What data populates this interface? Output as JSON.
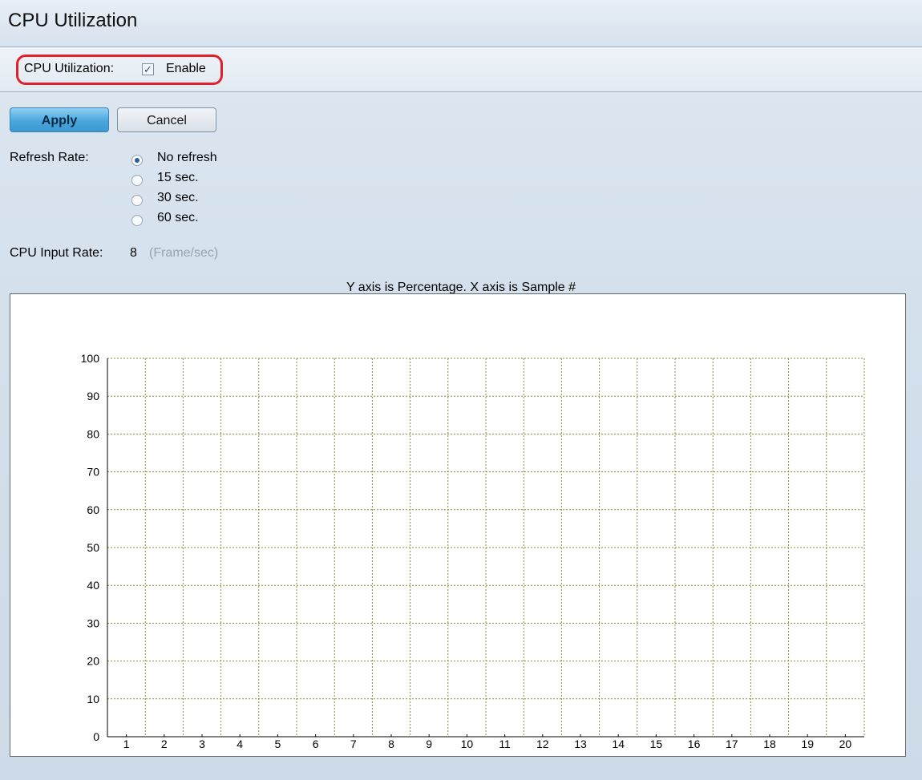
{
  "page": {
    "title": "CPU Utilization"
  },
  "settings": {
    "cpu_utilization_label": "CPU Utilization:",
    "enable_label": "Enable",
    "enable_checked": true
  },
  "buttons": {
    "apply": "Apply",
    "cancel": "Cancel"
  },
  "refresh": {
    "label": "Refresh Rate:",
    "options": [
      {
        "label": "No refresh",
        "selected": true
      },
      {
        "label": "15 sec.",
        "selected": false
      },
      {
        "label": "30 sec.",
        "selected": false
      },
      {
        "label": "60 sec.",
        "selected": false
      }
    ]
  },
  "input_rate": {
    "label": "CPU Input Rate:",
    "value": "8",
    "unit": "(Frame/sec)"
  },
  "chart_data": {
    "type": "line",
    "title": "Y axis is Percentage. X axis is Sample #",
    "xlabel": "",
    "ylabel": "",
    "x": [
      1,
      2,
      3,
      4,
      5,
      6,
      7,
      8,
      9,
      10,
      11,
      12,
      13,
      14,
      15,
      16,
      17,
      18,
      19,
      20
    ],
    "y_ticks": [
      0,
      10,
      20,
      30,
      40,
      50,
      60,
      70,
      80,
      90,
      100
    ],
    "ylim": [
      0,
      100
    ],
    "grid": true,
    "grid_color": "#8a8a3a",
    "series": []
  }
}
